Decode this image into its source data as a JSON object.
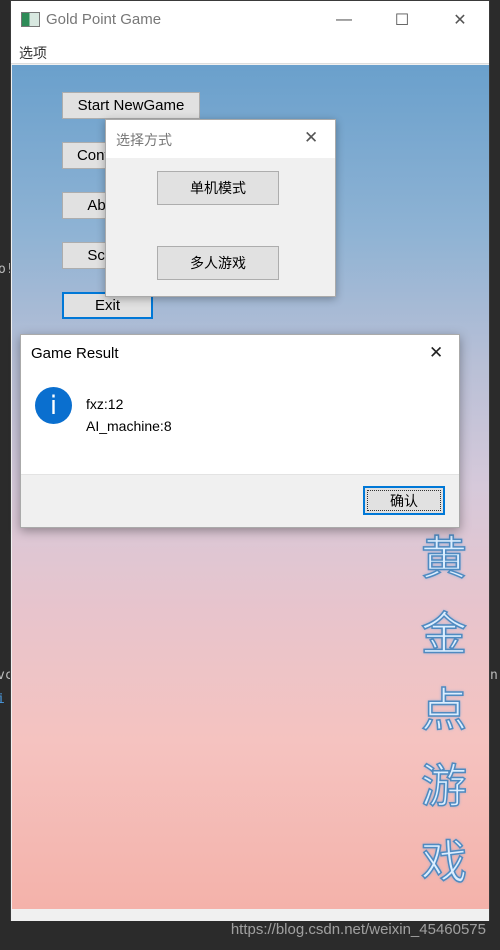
{
  "background_fragments": [
    "o!",
    "vc",
    "i",
    "n."
  ],
  "window": {
    "title": "Gold Point Game",
    "controls": {
      "minimize": "—",
      "maximize": "☐",
      "close": "✕"
    }
  },
  "menu": {
    "items": [
      "选项"
    ]
  },
  "main_buttons": [
    "Start NewGame",
    "Continue",
    "About",
    "Score",
    "Exit"
  ],
  "vertical_title": [
    "黄",
    "金",
    "点",
    "游",
    "戏"
  ],
  "select_dialog": {
    "title": "选择方式",
    "close": "✕",
    "options": [
      "单机模式",
      "多人游戏"
    ]
  },
  "result_dialog": {
    "title": "Game Result",
    "close": "✕",
    "icon": "info-icon",
    "icon_glyph": "i",
    "lines": [
      "fxz:12",
      "AI_machine:8"
    ],
    "ok_label": "确认"
  },
  "watermark": "https://blog.csdn.net/weixin_45460575",
  "colors": {
    "accent": "#0078d7",
    "info": "#0a6fcf"
  }
}
